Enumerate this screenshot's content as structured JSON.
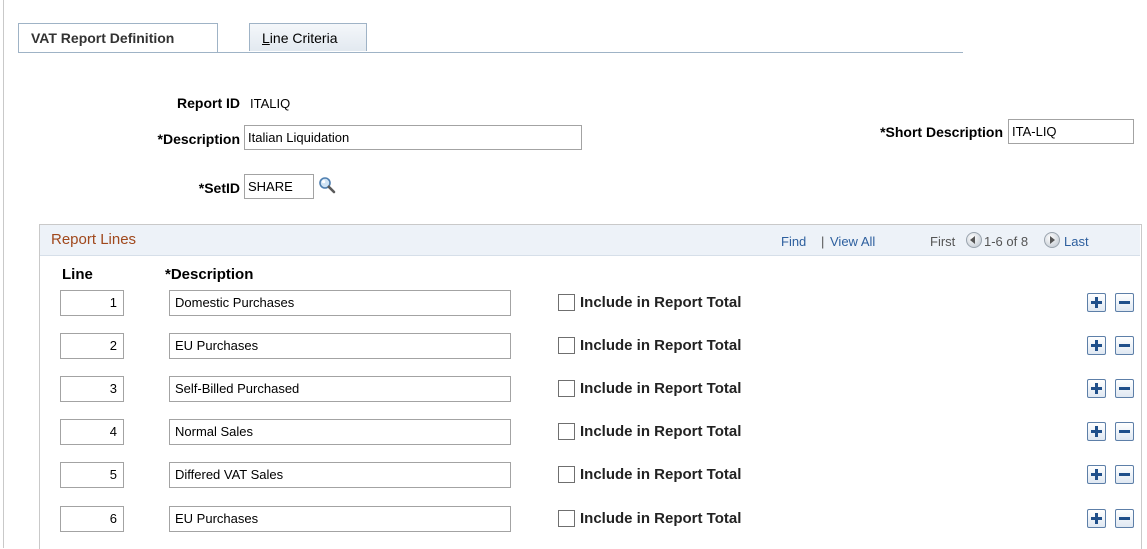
{
  "tabs": [
    {
      "label": "VAT Report Definition",
      "active": true
    },
    {
      "label_first": "L",
      "label_rest": "ine Criteria",
      "active": false
    }
  ],
  "header": {
    "report_id_label": "Report ID",
    "report_id_value": "ITALIQ",
    "description_label": "*Description",
    "description_value": "Italian Liquidation",
    "short_description_label": "*Short Description",
    "short_description_value": "ITA-LIQ",
    "setid_label": "*SetID",
    "setid_value": "SHARE"
  },
  "grid": {
    "title": "Report Lines",
    "find": "Find",
    "separator": "|",
    "view_all": "View All",
    "first": "First",
    "range": "1-6 of 8",
    "last": "Last",
    "col_line": "Line",
    "col_description": "*Description",
    "checkbox_label": "Include in Report Total",
    "rows": [
      {
        "line": "1",
        "description": "Domestic Purchases",
        "include": false
      },
      {
        "line": "2",
        "description": "EU Purchases",
        "include": false
      },
      {
        "line": "3",
        "description": "Self-Billed Purchased",
        "include": false
      },
      {
        "line": "4",
        "description": "Normal Sales",
        "include": false
      },
      {
        "line": "5",
        "description": "Differed VAT Sales",
        "include": false
      },
      {
        "line": "6",
        "description": "EU Purchases",
        "include": false
      }
    ]
  },
  "icons": {
    "lookup": "magnifier-icon",
    "add": "plus-icon",
    "delete": "minus-icon",
    "prev": "arrow-left-icon",
    "next": "arrow-right-icon"
  },
  "colors": {
    "grid_title": "#a0481c",
    "link": "#2d5f9e",
    "grid_header_bg": "#edf2f8"
  }
}
